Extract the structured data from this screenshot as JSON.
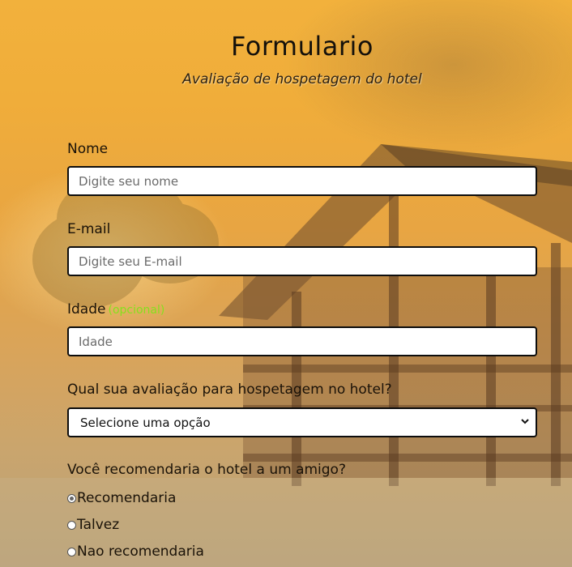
{
  "header": {
    "title": "Formulario",
    "subtitle": "Avaliação de hospetagem do hotel"
  },
  "form": {
    "name": {
      "label": "Nome",
      "placeholder": "Digite seu nome",
      "value": ""
    },
    "email": {
      "label": "E-mail",
      "placeholder": "Digite seu E-mail",
      "value": ""
    },
    "age": {
      "label": "Idade",
      "optional_tag": "(opcional)",
      "placeholder": "Idade",
      "value": ""
    },
    "rating": {
      "label": "Qual sua avaliação para hospetagem no hotel?",
      "selected": "Selecione uma opção"
    },
    "recommend": {
      "label": "Você recomendaria o hotel a um amigo?",
      "options": [
        {
          "label": "Recomendaria",
          "checked": true
        },
        {
          "label": "Talvez",
          "checked": false
        },
        {
          "label": "Nao recomendaria",
          "checked": false
        }
      ]
    }
  },
  "colors": {
    "optional_accent": "#86e01e",
    "field_border": "#0d0d0d",
    "background_warm": "#f0ad3a"
  },
  "icons": {
    "select_arrow": "chevron-down-icon",
    "background": "wooden-cabin-illustration"
  }
}
